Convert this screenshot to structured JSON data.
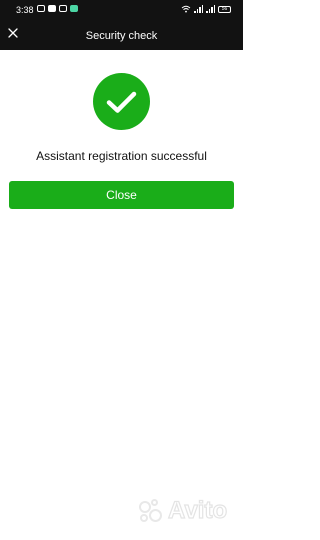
{
  "status_bar": {
    "time": "3:38",
    "battery": "56"
  },
  "header": {
    "title": "Security check",
    "close_icon": "close-icon"
  },
  "main": {
    "success_icon": "checkmark-icon",
    "message": "Assistant registration successful",
    "close_button_label": "Close"
  },
  "watermark": {
    "text": "Avito"
  },
  "colors": {
    "header_bg": "#121212",
    "accent_green": "#1aad19",
    "text": "#111111",
    "background": "#ffffff"
  }
}
